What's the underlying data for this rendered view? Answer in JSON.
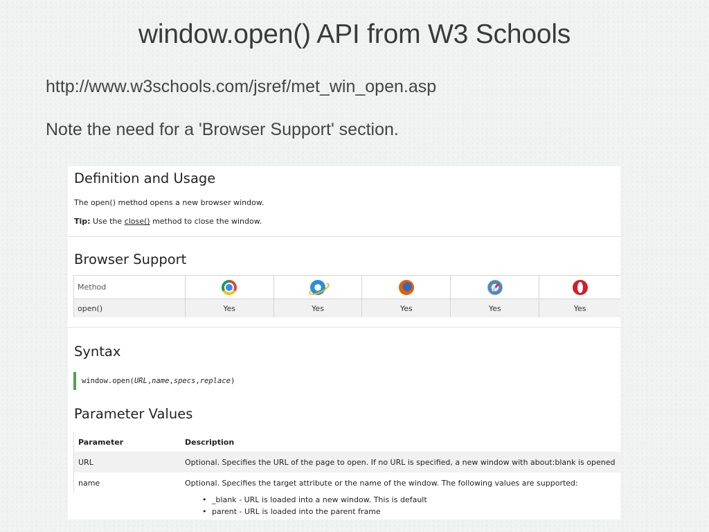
{
  "slide": {
    "title": "window.open() API from W3 Schools",
    "url": "http://www.w3schools.com/jsref/met_win_open.asp",
    "note": "Note the need for a 'Browser Support' section."
  },
  "definition": {
    "heading": "Definition and Usage",
    "text": "The open() method opens a new browser window.",
    "tip_label": "Tip:",
    "tip_before": "Use the",
    "tip_link": "close()",
    "tip_after": "method to close the window."
  },
  "browser_support": {
    "heading": "Browser Support",
    "method_header": "Method",
    "browsers": [
      {
        "icon": "chrome-icon"
      },
      {
        "icon": "internet-explorer-icon"
      },
      {
        "icon": "firefox-icon"
      },
      {
        "icon": "safari-icon"
      },
      {
        "icon": "opera-icon"
      }
    ],
    "row": {
      "method": "open()",
      "values": [
        "Yes",
        "Yes",
        "Yes",
        "Yes",
        "Yes"
      ]
    }
  },
  "syntax": {
    "heading": "Syntax",
    "prefix": "window.open(",
    "params": [
      "URL",
      "name",
      "specs",
      "replace"
    ],
    "sep": ",",
    "suffix": ")"
  },
  "parameters": {
    "heading": "Parameter Values",
    "columns": [
      "Parameter",
      "Description"
    ],
    "rows": [
      {
        "name": "URL",
        "description": "Optional. Specifies the URL of the page to open. If no URL is specified, a new window with about:blank is opened"
      },
      {
        "name": "name",
        "description": "Optional. Specifies the target attribute or the name of the window. The following values are supported:"
      }
    ],
    "bullets": [
      "_blank - URL is loaded into a new window. This is default",
      "parent - URL is loaded into the parent frame"
    ]
  }
}
